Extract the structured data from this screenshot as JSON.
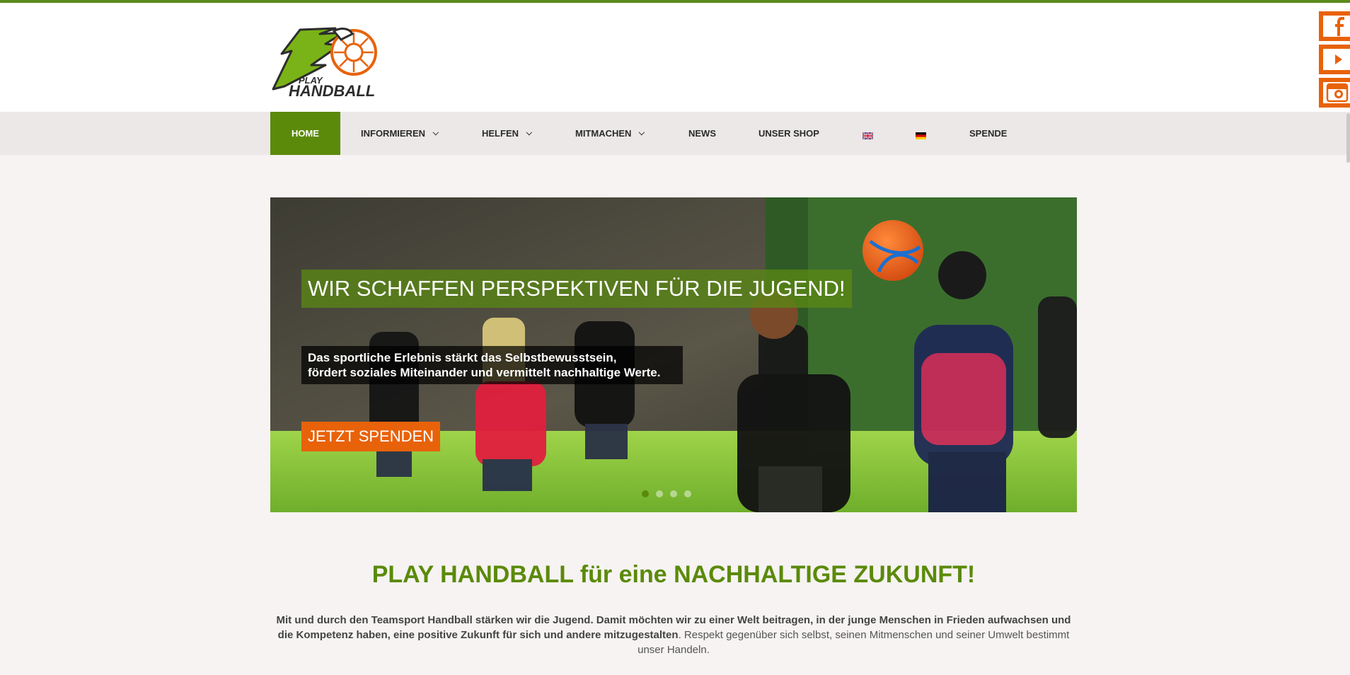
{
  "site": {
    "logo_text_top": "PLAY",
    "logo_text_bottom": "HANDBALL",
    "brand_green": "#5b8a0a",
    "brand_orange": "#e8620a"
  },
  "social": [
    {
      "name": "facebook-icon"
    },
    {
      "name": "youtube-icon"
    },
    {
      "name": "instagram-icon"
    }
  ],
  "nav": {
    "home": "HOME",
    "informieren": "INFORMIEREN",
    "helfen": "HELFEN",
    "mitmachen": "MITMACHEN",
    "news": "NEWS",
    "shop": "UNSER SHOP",
    "flag_en": "english-flag-icon",
    "flag_de": "german-flag-icon",
    "spende": "SPENDE"
  },
  "slider": {
    "title": "WIR SCHAFFEN PERSPEKTIVEN FÜR DIE JUGEND!",
    "text_line1": "Das sportliche Erlebnis stärkt das Selbstbewusstsein,",
    "text_line2": "fördert soziales Miteinander und vermittelt nachhaltige Werte.",
    "cta": "JETZT SPENDEN",
    "slide_count": 4,
    "active_slide": 1
  },
  "main": {
    "headline": "PLAY HANDBALL für eine NACHHALTIGE ZUKUNFT!",
    "intro_bold": "Mit und durch den Teamsport Handball stärken wir die Jugend. Damit möchten wir zu einer Welt beitragen, in der junge Menschen in Frieden aufwachsen und die Kompetenz haben, eine positive Zukunft für sich und andere mitzugestalten",
    "intro_rest": ". Respekt gegenüber sich selbst, seinen Mitmenschen und seiner Umwelt bestimmt unser Handeln."
  }
}
